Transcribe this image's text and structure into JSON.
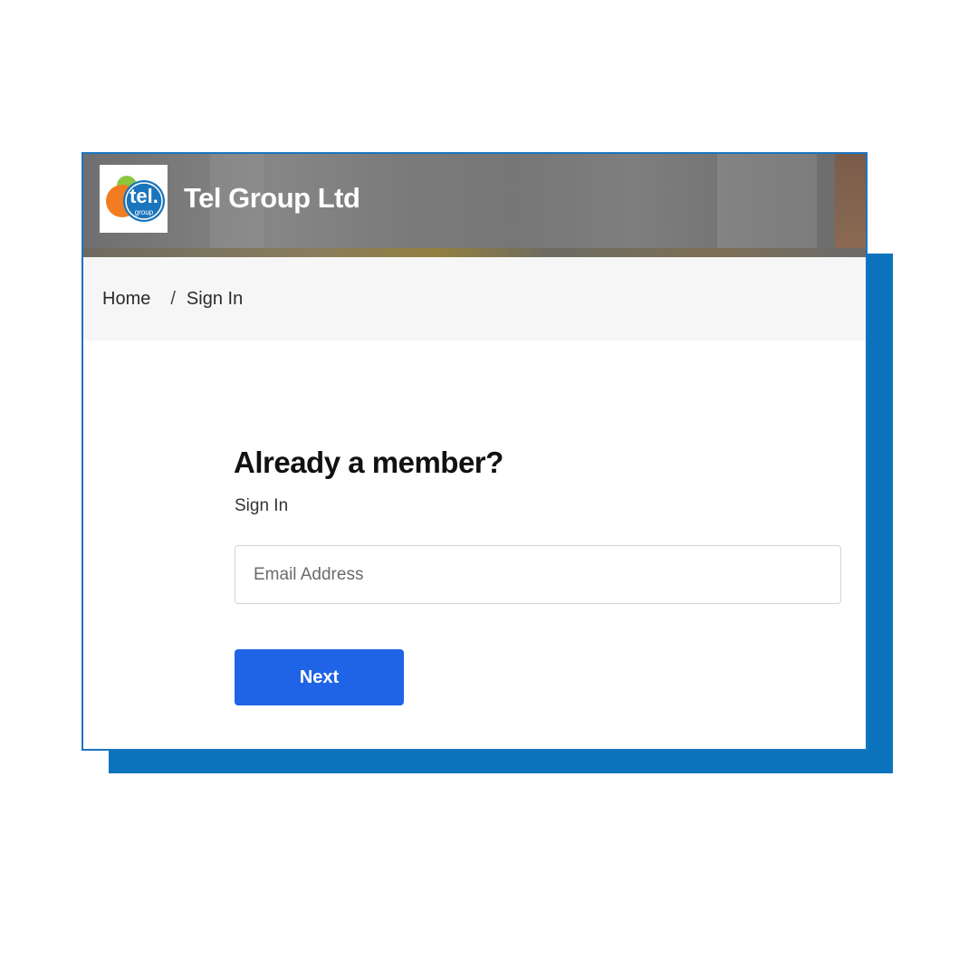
{
  "header": {
    "logo_alt": "tel group",
    "logo_icon": "tel-group-logo",
    "company_name": "Tel Group Ltd"
  },
  "breadcrumb": {
    "home": "Home",
    "separator": "/",
    "current": "Sign In"
  },
  "signin": {
    "heading": "Already a member?",
    "subheading": "Sign In",
    "email_placeholder": "Email Address",
    "email_value": "",
    "next_label": "Next"
  },
  "colors": {
    "accent_blue": "#0b73bd",
    "button_blue": "#1f64e6",
    "logo_orange": "#f27c21",
    "logo_green": "#8cc63f",
    "logo_blue": "#1b75bc"
  }
}
